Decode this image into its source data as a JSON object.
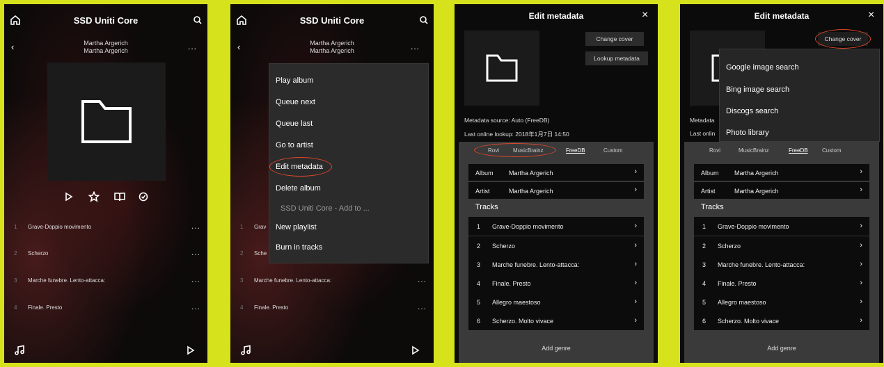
{
  "app_title": "SSD Uniti Core",
  "album_artist_line1": "Martha Argerich",
  "album_artist_line2": "Martha Argerich",
  "more_label": "...",
  "tracks": [
    {
      "num": "1",
      "name": "Grave-Doppio movimento"
    },
    {
      "num": "2",
      "name": "Scherzo"
    },
    {
      "num": "3",
      "name": "Marche funebre. Lento-attacca:"
    },
    {
      "num": "4",
      "name": "Finale. Presto"
    }
  ],
  "context_menu": {
    "items": [
      "Play album",
      "Queue next",
      "Queue last",
      "Go to artist",
      "Edit metadata",
      "Delete album",
      "SSD Uniti Core - Add to ...",
      "New playlist",
      "Burn in tracks"
    ],
    "partial_tracks": [
      "Grav",
      "Sche",
      "Marche funebre. Lento-attacca:",
      "Finale. Presto"
    ]
  },
  "edit": {
    "title": "Edit metadata",
    "close": "×",
    "change_cover": "Change cover",
    "lookup_metadata": "Lookup metadata",
    "metadata_source": "Metadata source:  Auto (FreeDB)",
    "last_lookup": "Last online lookup: 2018年1月7日 14:50",
    "sources": [
      "Rovi",
      "MusicBrainz",
      "FreeDB",
      "Custom"
    ],
    "album_label": "Album",
    "album_value": "Martha Argerich",
    "artist_label": "Artist",
    "artist_value": "Martha Argerich",
    "tracks_header": "Tracks",
    "tracks": [
      {
        "num": "1",
        "name": "Grave-Doppio movimento"
      },
      {
        "num": "2",
        "name": "Scherzo"
      },
      {
        "num": "3",
        "name": "Marche funebre. Lento-attacca:"
      },
      {
        "num": "4",
        "name": "Finale. Presto"
      },
      {
        "num": "5",
        "name": "Allegro maestoso"
      },
      {
        "num": "6",
        "name": "Scherzo. Molto vivace"
      }
    ],
    "add_genre": "Add genre",
    "chevron": "›"
  },
  "cover_menu": [
    "Google image search",
    "Bing image search",
    "Discogs search",
    "Photo library"
  ],
  "screen4_partial": {
    "metadata": "Metadata",
    "last": "Last onlin"
  },
  "colors": {
    "background": "#d6e21c",
    "highlight": "#e0462b"
  }
}
